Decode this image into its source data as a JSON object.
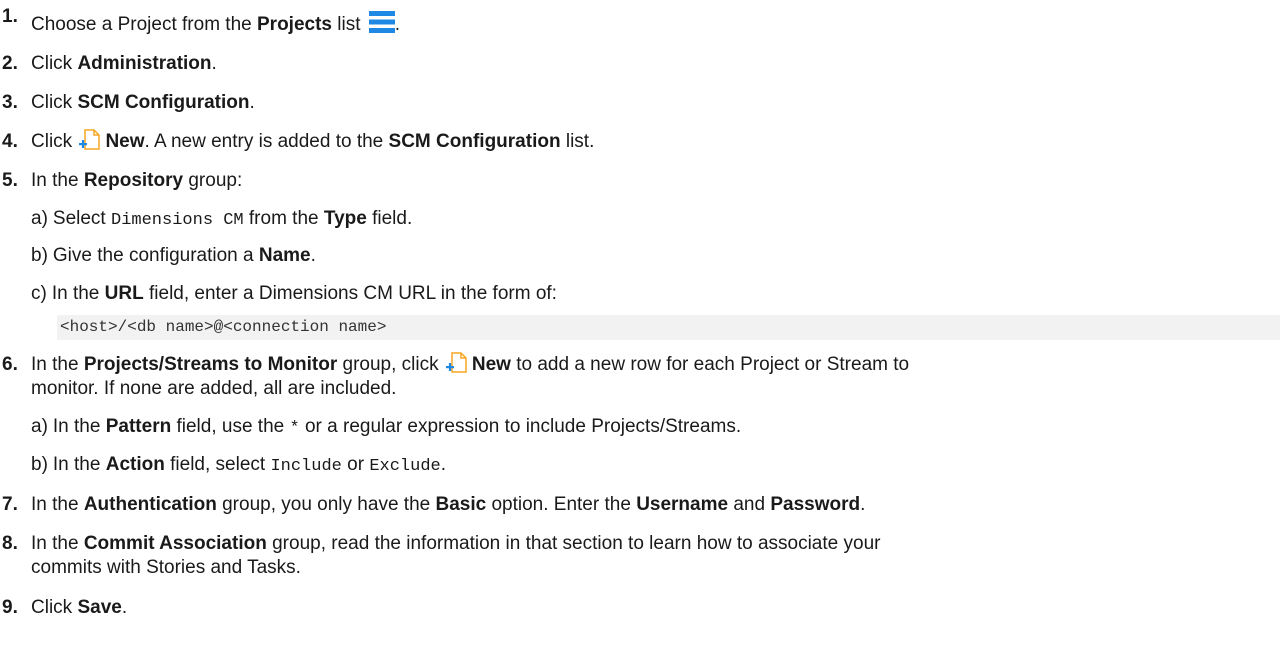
{
  "steps": [
    {
      "num": "1.",
      "parts": [
        "Choose a Project from the ",
        "Projects",
        " list",
        "."
      ]
    },
    {
      "num": "2.",
      "parts": [
        "Click ",
        "Administration",
        "."
      ]
    },
    {
      "num": "3.",
      "parts": [
        "Click ",
        "SCM Configuration",
        "."
      ]
    },
    {
      "num": "4.",
      "parts": [
        "Click ",
        "New",
        ". A new entry is added to the ",
        "SCM Configuration",
        " list."
      ]
    },
    {
      "num": "5.",
      "parts": [
        "In the ",
        "Repository",
        " group:"
      ]
    },
    {
      "num": "6.",
      "parts": [
        "In the ",
        "Projects/Streams to Monitor",
        " group, click ",
        "New",
        " to add a new row for each Project or Stream to"
      ],
      "cont": "monitor. If none are added, all are included."
    },
    {
      "num": "7.",
      "parts": [
        "In the ",
        "Authentication",
        " group, you only have the ",
        "Basic",
        " option. Enter the ",
        "Username",
        " and ",
        "Password",
        "."
      ]
    },
    {
      "num": "8.",
      "parts": [
        "In the ",
        "Commit Association",
        " group, read the information in that section to learn how to associate your"
      ],
      "cont": "commits with Stories and Tasks."
    },
    {
      "num": "9.",
      "parts": [
        "Click ",
        "Save",
        "."
      ]
    }
  ],
  "sub5": [
    {
      "label": "a)",
      "parts": [
        "Select ",
        "Dimensions CM",
        " from the ",
        "Type",
        " field."
      ]
    },
    {
      "label": "b)",
      "parts": [
        "Give the configuration a ",
        "Name",
        "."
      ]
    },
    {
      "label": "c)",
      "parts": [
        "In the ",
        "URL",
        " field, enter a Dimensions CM URL in the form of:"
      ]
    }
  ],
  "code": "<host>/<db name>@<connection name>",
  "sub6": [
    {
      "label": "a)",
      "parts": [
        "In the ",
        "Pattern",
        " field, use the ",
        "*",
        " or a regular expression to include Projects/Streams."
      ]
    },
    {
      "label": "b)",
      "parts": [
        "In the ",
        "Action",
        " field, select ",
        "Include",
        " or ",
        "Exclude",
        "."
      ]
    }
  ],
  "icons": {
    "list": "list-icon",
    "new": "new-document-icon"
  },
  "colors": {
    "list_icon": "#1e88e5",
    "new_icon_fill": "#ffffff",
    "new_icon_stroke": "#f5a623",
    "new_icon_plus": "#1e88e5"
  }
}
